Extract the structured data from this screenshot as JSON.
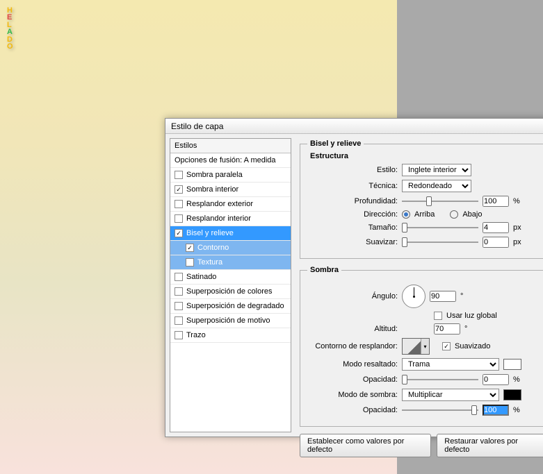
{
  "canvas_letters": [
    "H",
    "E",
    "L",
    "A",
    "D",
    "O"
  ],
  "letter_colors": [
    "#f2b90d",
    "#e04646",
    "#f2b90d",
    "#2fb94c",
    "#f2b90d",
    "#f2b90d"
  ],
  "dialog": {
    "title": "Estilo de capa",
    "sidebar": {
      "header": "Estilos",
      "blend_opts": "Opciones de fusión: A medida",
      "items": [
        {
          "label": "Sombra paralela",
          "checked": false
        },
        {
          "label": "Sombra interior",
          "checked": true
        },
        {
          "label": "Resplandor exterior",
          "checked": false
        },
        {
          "label": "Resplandor interior",
          "checked": false
        },
        {
          "label": "Bisel y relieve",
          "checked": true,
          "selected": true
        },
        {
          "label": "Contorno",
          "checked": true,
          "sub": true
        },
        {
          "label": "Textura",
          "checked": false,
          "sub": true
        },
        {
          "label": "Satinado",
          "checked": false
        },
        {
          "label": "Superposición de colores",
          "checked": false
        },
        {
          "label": "Superposición de degradado",
          "checked": false
        },
        {
          "label": "Superposición de motivo",
          "checked": false
        },
        {
          "label": "Trazo",
          "checked": false
        }
      ]
    },
    "panel": {
      "title": "Bisel y relieve",
      "structure": {
        "legend": "Estructura",
        "style_label": "Estilo:",
        "style_value": "Inglete interior",
        "technique_label": "Técnica:",
        "technique_value": "Redondeado",
        "depth_label": "Profundidad:",
        "depth_value": "100",
        "depth_unit": "%",
        "direction_label": "Dirección:",
        "up": "Arriba",
        "down": "Abajo",
        "size_label": "Tamaño:",
        "size_value": "4",
        "size_unit": "px",
        "soften_label": "Suavizar:",
        "soften_value": "0",
        "soften_unit": "px"
      },
      "shadow": {
        "legend": "Sombra",
        "angle_label": "Ángulo:",
        "angle_value": "90",
        "deg": "°",
        "use_global": "Usar luz global",
        "use_global_checked": false,
        "altitude_label": "Altitud:",
        "altitude_value": "70",
        "gloss_label": "Contorno de resplandor:",
        "anti_alias": "Suavizado",
        "anti_alias_checked": true,
        "highlight_mode_label": "Modo resaltado:",
        "highlight_mode_value": "Trama",
        "highlight_color": "#ffffff",
        "highlight_opacity_label": "Opacidad:",
        "highlight_opacity_value": "0",
        "pct": "%",
        "shadow_mode_label": "Modo de sombra:",
        "shadow_mode_value": "Multiplicar",
        "shadow_color": "#000000",
        "shadow_opacity_label": "Opacidad:",
        "shadow_opacity_value": "100"
      },
      "buttons": {
        "defaults": "Establecer como valores por defecto",
        "reset": "Restaurar valores por defecto"
      }
    }
  }
}
